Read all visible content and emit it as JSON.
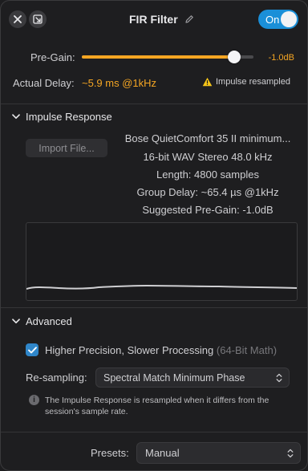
{
  "titlebar": {
    "title": "FIR Filter",
    "toggle_label": "On",
    "icons": {
      "close": "close-icon",
      "pin": "pin-window-icon",
      "edit": "pencil-icon"
    }
  },
  "pregain": {
    "label": "Pre-Gain:",
    "value": "-1.0dB",
    "slider_level": 0.92
  },
  "delay": {
    "label": "Actual Delay:",
    "value": "~5.9 ms @1kHz",
    "warning": "Impulse resampled"
  },
  "impulse": {
    "section_label": "Impulse Response",
    "import_button": "Import File...",
    "info": [
      "Bose QuietComfort 35 II minimum...",
      "16-bit WAV Stereo 48.0 kHz",
      "Length: 4800 samples",
      "Group Delay: ~65.4 µs @1kHz",
      "Suggested Pre-Gain: -1.0dB"
    ]
  },
  "advanced": {
    "section_label": "Advanced",
    "checkbox_label": "Higher Precision, Slower Processing",
    "checkbox_hint": "(64-Bit Math)",
    "checkbox_checked": true,
    "resampling_label": "Re-sampling:",
    "resampling_value": "Spectral Match Minimum Phase",
    "note": "The Impulse Response is resampled when it differs from the session's sample rate."
  },
  "presets": {
    "label": "Presets:",
    "value": "Manual"
  },
  "colors": {
    "accent_orange": "#f5a623",
    "toggle_blue": "#1a8fd8",
    "checkbox_blue": "#2f86c9",
    "background": "#1e1e20"
  }
}
